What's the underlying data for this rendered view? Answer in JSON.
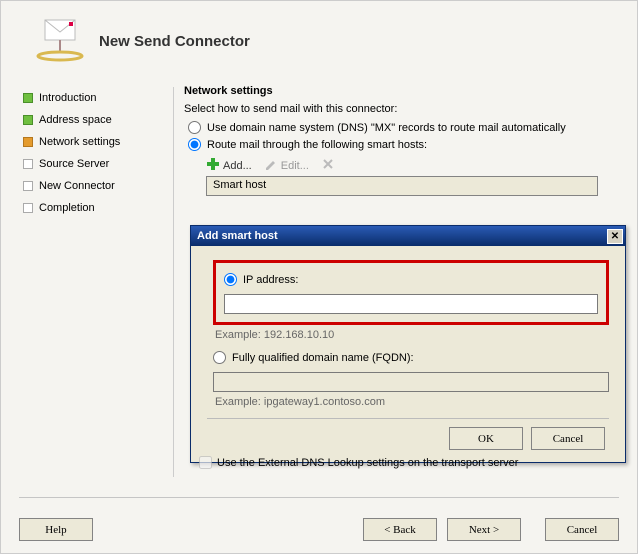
{
  "header": {
    "title": "New Send Connector"
  },
  "sidebar": {
    "items": [
      {
        "label": "Introduction",
        "state": "green"
      },
      {
        "label": "Address space",
        "state": "green"
      },
      {
        "label": "Network settings",
        "state": "orange"
      },
      {
        "label": "Source Server",
        "state": "gray"
      },
      {
        "label": "New Connector",
        "state": "gray"
      },
      {
        "label": "Completion",
        "state": "gray"
      }
    ]
  },
  "main": {
    "section_title": "Network settings",
    "prompt": "Select how to send mail with this connector:",
    "radio_dns": "Use domain name system (DNS) \"MX\" records to route mail automatically",
    "radio_smarthost": "Route mail through the following smart hosts:",
    "toolbar": {
      "add": "Add...",
      "edit": "Edit...",
      "delete": ""
    },
    "grid_header": "Smart host",
    "ext_dns": "Use the External DNS Lookup settings on the transport server"
  },
  "dialog": {
    "title": "Add smart host",
    "radio_ip": "IP address:",
    "ip_value": "",
    "example_ip": "Example: 192.168.10.10",
    "radio_fqdn": "Fully qualified domain name (FQDN):",
    "fqdn_value": "",
    "example_fqdn": "Example: ipgateway1.contoso.com",
    "ok": "OK",
    "cancel": "Cancel"
  },
  "footer": {
    "help": "Help",
    "back": "< Back",
    "next": "Next >",
    "cancel": "Cancel"
  }
}
